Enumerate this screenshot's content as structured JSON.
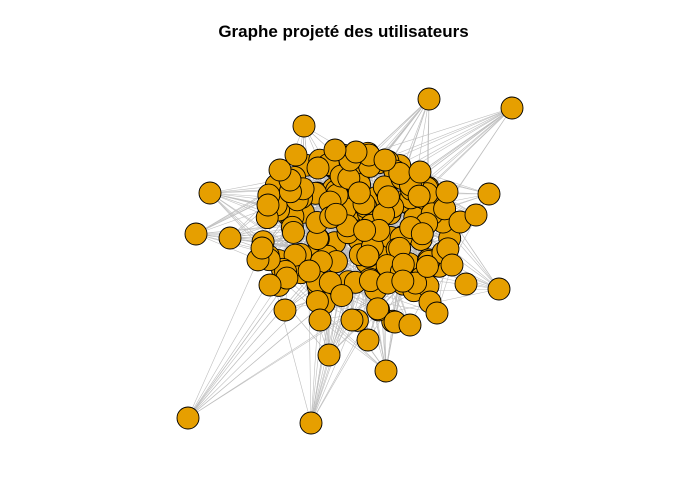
{
  "title": "Graphe projeté des utilisateurs",
  "colors": {
    "node_fill": "#E69F00",
    "node_stroke": "#000000",
    "edge": "#BEBEBE",
    "background": "#FFFFFF"
  }
}
